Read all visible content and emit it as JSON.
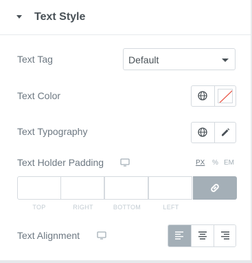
{
  "section": {
    "title": "Text Style",
    "expanded": true
  },
  "text_tag": {
    "label": "Text Tag",
    "value": "Default"
  },
  "text_color": {
    "label": "Text Color",
    "swatch": "none"
  },
  "text_typography": {
    "label": "Text Typography"
  },
  "text_holder_padding": {
    "label": "Text Holder Padding",
    "units": [
      "PX",
      "%",
      "EM"
    ],
    "active_unit": "PX",
    "fields": [
      {
        "label": "TOP",
        "value": ""
      },
      {
        "label": "RIGHT",
        "value": ""
      },
      {
        "label": "BOTTOM",
        "value": ""
      },
      {
        "label": "LEFT",
        "value": ""
      }
    ],
    "linked": true
  },
  "text_alignment": {
    "label": "Text Alignment",
    "options": [
      "left",
      "center",
      "right"
    ],
    "active": "left"
  },
  "colors": {
    "accent_gray": "#a4afb7",
    "border": "#d5dadf",
    "label": "#6d7882",
    "heading": "#495157"
  }
}
